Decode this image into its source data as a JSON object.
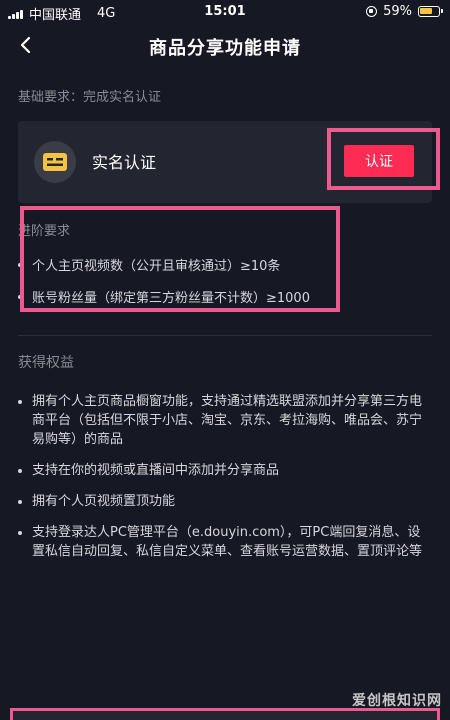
{
  "status": {
    "carrier": "中国联通",
    "network": "4G",
    "time": "15:01",
    "battery": "59%"
  },
  "header": {
    "title": "商品分享功能申请"
  },
  "basic": {
    "label": "基础要求：完成实名认证"
  },
  "verify_card": {
    "label": "实名认证",
    "button": "认证",
    "icon": "id-card-icon"
  },
  "advanced": {
    "label": "进阶要求",
    "items": [
      "个人主页视频数（公开且审核通过）≥10条",
      "账号粉丝量（绑定第三方粉丝量不计数）≥1000"
    ]
  },
  "benefits": {
    "label": "获得权益",
    "items": [
      "拥有个人主页商品橱窗功能，支持通过精选联盟添加并分享第三方电商平台（包括但不限于小店、淘宝、京东、考拉海购、唯品会、苏宁易购等）的商品",
      "支持在你的视频或直播间中添加并分享商品",
      "拥有个人页视频置顶功能",
      "支持登录达人PC管理平台（e.douyin.com），可PC端回复消息、设置私信自动回复、私信自定义菜单、查看账号运营数据、置顶评论等"
    ]
  },
  "watermark": "爱创根知识网",
  "colors": {
    "background": "#161823",
    "card": "#232531",
    "accent": "#fe2c55",
    "highlight": "#ec5a8e",
    "icon_yellow": "#f5c342"
  }
}
